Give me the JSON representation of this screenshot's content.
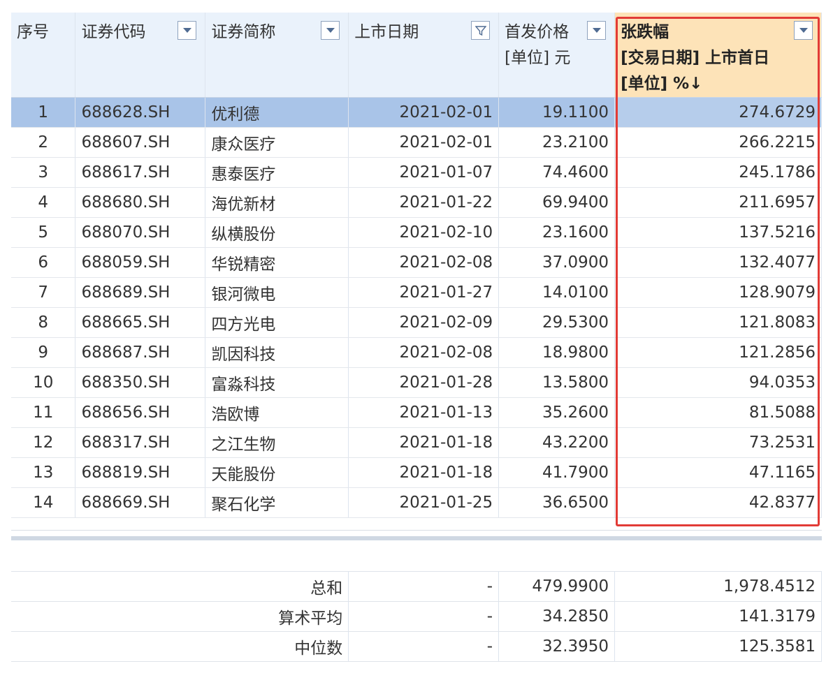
{
  "columns": {
    "index": "序号",
    "code": "证券代码",
    "name": "证券简称",
    "list_date": "上市日期",
    "ipo_price_line1": "首发价格",
    "ipo_price_line2": "[单位] 元",
    "change_line1": "张跌幅",
    "change_line2": "[交易日期] 上市首日",
    "change_line3": "[单位] %↓"
  },
  "rows": [
    {
      "idx": "1",
      "code": "688628.SH",
      "name": "优利德",
      "date": "2021-02-01",
      "price": "19.1100",
      "change": "274.6729"
    },
    {
      "idx": "2",
      "code": "688607.SH",
      "name": "康众医疗",
      "date": "2021-02-01",
      "price": "23.2100",
      "change": "266.2215"
    },
    {
      "idx": "3",
      "code": "688617.SH",
      "name": "惠泰医疗",
      "date": "2021-01-07",
      "price": "74.4600",
      "change": "245.1786"
    },
    {
      "idx": "4",
      "code": "688680.SH",
      "name": "海优新材",
      "date": "2021-01-22",
      "price": "69.9400",
      "change": "211.6957"
    },
    {
      "idx": "5",
      "code": "688070.SH",
      "name": "纵横股份",
      "date": "2021-02-10",
      "price": "23.1600",
      "change": "137.5216"
    },
    {
      "idx": "6",
      "code": "688059.SH",
      "name": "华锐精密",
      "date": "2021-02-08",
      "price": "37.0900",
      "change": "132.4077"
    },
    {
      "idx": "7",
      "code": "688689.SH",
      "name": "银河微电",
      "date": "2021-01-27",
      "price": "14.0100",
      "change": "128.9079"
    },
    {
      "idx": "8",
      "code": "688665.SH",
      "name": "四方光电",
      "date": "2021-02-09",
      "price": "29.5300",
      "change": "121.8083"
    },
    {
      "idx": "9",
      "code": "688687.SH",
      "name": "凯因科技",
      "date": "2021-02-08",
      "price": "18.9800",
      "change": "121.2856"
    },
    {
      "idx": "10",
      "code": "688350.SH",
      "name": "富淼科技",
      "date": "2021-01-28",
      "price": "13.5800",
      "change": "94.0353"
    },
    {
      "idx": "11",
      "code": "688656.SH",
      "name": "浩欧博",
      "date": "2021-01-13",
      "price": "35.2600",
      "change": "81.5088"
    },
    {
      "idx": "12",
      "code": "688317.SH",
      "name": "之江生物",
      "date": "2021-01-18",
      "price": "43.2200",
      "change": "73.2531"
    },
    {
      "idx": "13",
      "code": "688819.SH",
      "name": "天能股份",
      "date": "2021-01-18",
      "price": "41.7900",
      "change": "47.1165"
    },
    {
      "idx": "14",
      "code": "688669.SH",
      "name": "聚石化学",
      "date": "2021-01-25",
      "price": "36.6500",
      "change": "42.8377"
    }
  ],
  "summary": [
    {
      "label": "总和",
      "date": "-",
      "price": "479.9900",
      "change": "1,978.4512"
    },
    {
      "label": "算术平均",
      "date": "-",
      "price": "34.2850",
      "change": "141.3179"
    },
    {
      "label": "中位数",
      "date": "-",
      "price": "32.3950",
      "change": "125.3581"
    }
  ],
  "icons": {
    "filter": "filter-dropdown-icon",
    "funnel": "funnel-filter-icon"
  },
  "colors": {
    "header_bg": "#eaf2fb",
    "highlight_header_bg": "#fde3b8",
    "selected_row_bg": "#a9c4e8",
    "annotation_border": "#e23b36"
  }
}
